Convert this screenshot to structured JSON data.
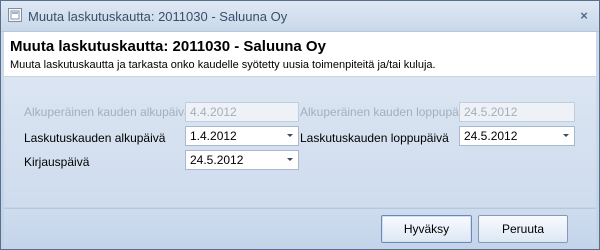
{
  "window": {
    "title": "Muuta laskutuskautta: 2011030 - Saluuna Oy",
    "close_glyph": "×"
  },
  "header": {
    "title": "Muuta laskutuskautta: 2011030 - Saluuna Oy",
    "description": "Muuta laskutuskautta ja tarkasta onko kaudelle syötetty uusia toimenpiteitä ja/tai kuluja."
  },
  "form": {
    "orig_start_label": "Alkuperäinen kauden alkupäivä",
    "orig_start_value": "4.4.2012",
    "orig_end_label": "Alkuperäinen kauden loppupäivä",
    "orig_end_value": "24.5.2012",
    "period_start_label": "Laskutuskauden alkupäivä",
    "period_start_value": "1.4.2012",
    "period_end_label": "Laskutuskauden loppupäivä",
    "period_end_value": "24.5.2012",
    "posting_date_label": "Kirjauspäivä",
    "posting_date_value": "24.5.2012"
  },
  "buttons": {
    "ok_label": "Hyväksy",
    "cancel_label": "Peruuta"
  }
}
